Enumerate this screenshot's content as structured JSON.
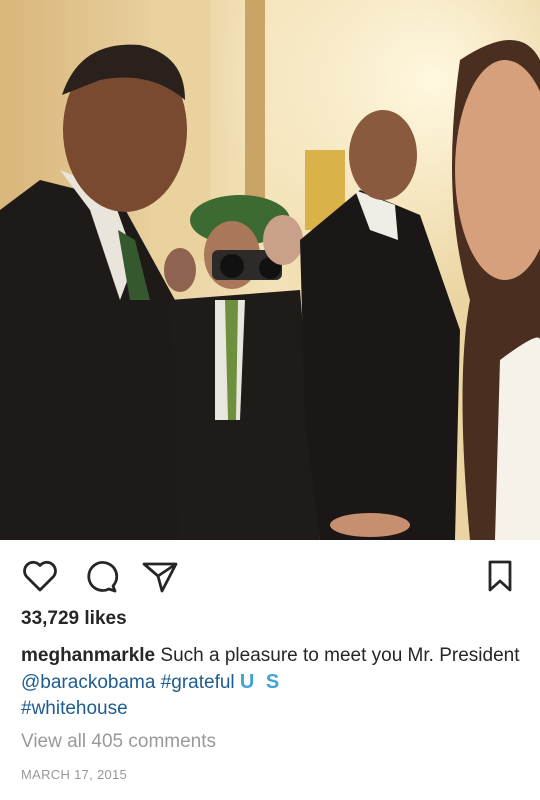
{
  "post": {
    "image": {
      "description_icon": "photo-icon"
    },
    "actions": {
      "like_icon": "heart-icon",
      "comment_icon": "comment-icon",
      "share_icon": "send-icon",
      "save_icon": "bookmark-icon"
    },
    "likes_text": "33,729 likes",
    "caption": {
      "username": "meghanmarkle",
      "text": " Such a pleasure to meet you Mr. President ",
      "mention": "@barackobama",
      "hashtag1": " #grateful ",
      "flag_text": "U S",
      "hashtag2": "#whitehouse"
    },
    "view_comments": "View all 405 comments",
    "date": "MARCH 17, 2015"
  },
  "colors": {
    "link": "#1d5c91",
    "muted": "#999999",
    "text": "#262626"
  }
}
